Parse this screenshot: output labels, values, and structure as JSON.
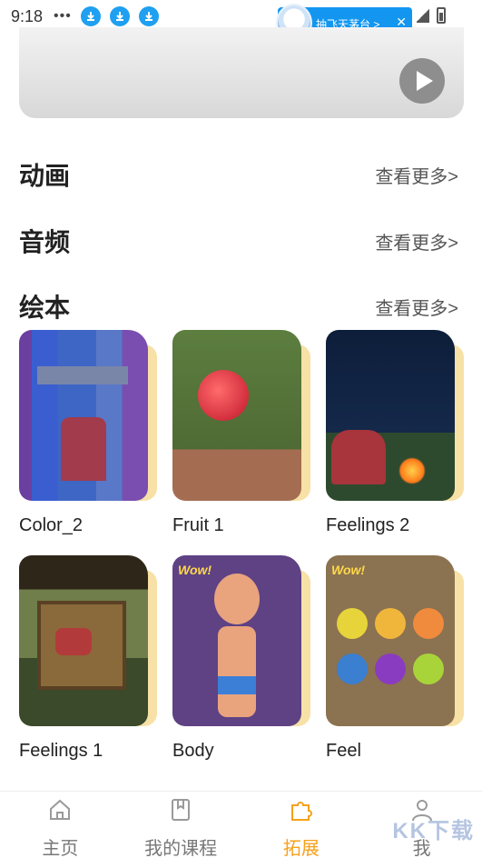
{
  "status_bar": {
    "time": "9:18",
    "dots": "•••"
  },
  "ad": {
    "text": "抽飞天茅台 >",
    "close": "✕"
  },
  "sections": [
    {
      "title": "动画",
      "more": "查看更多>"
    },
    {
      "title": "音频",
      "more": "查看更多>"
    },
    {
      "title": "绘本",
      "more": "查看更多>"
    }
  ],
  "books": [
    {
      "title": "Color_2"
    },
    {
      "title": "Fruit 1"
    },
    {
      "title": "Feelings 2"
    },
    {
      "title": "Feelings 1"
    },
    {
      "title": "Body"
    },
    {
      "title": "Feel"
    }
  ],
  "cover_labels": {
    "wow": "Wow!"
  },
  "nav": [
    {
      "label": "主页",
      "icon": "home-icon"
    },
    {
      "label": "我的课程",
      "icon": "bookmark-icon"
    },
    {
      "label": "拓展",
      "icon": "puzzle-icon",
      "active": true
    },
    {
      "label": "我",
      "icon": "user-icon"
    }
  ],
  "watermark": "KK下载",
  "colors": {
    "accent": "#f5a11d",
    "download_icon": "#1fa0f0",
    "ad_bg": "#1296f0"
  }
}
